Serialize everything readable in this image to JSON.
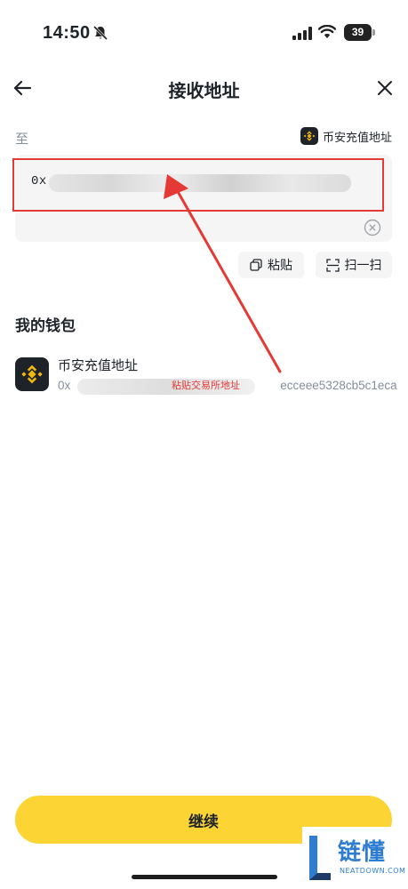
{
  "status_bar": {
    "time": "14:50",
    "battery": "39"
  },
  "nav": {
    "title": "接收地址"
  },
  "form": {
    "to_label": "至",
    "address_source_label": "币安充值地址",
    "address_value": "0x",
    "paste_label": "粘贴",
    "scan_label": "扫一扫"
  },
  "wallet": {
    "section_title": "我的钱包",
    "items": [
      {
        "name": "币安充值地址",
        "address": "0x",
        "address_tail": "ecceee5328cb5c1eca"
      }
    ]
  },
  "annotation": {
    "text": "粘贴交易所地址"
  },
  "footer": {
    "continue_label": "继续"
  },
  "watermark": {
    "text": "链懂",
    "subtext": "NEATDOWN.COM"
  },
  "colors": {
    "accent": "#fcd535",
    "annotation": "#e53935",
    "brand_dark": "#1e2329"
  }
}
